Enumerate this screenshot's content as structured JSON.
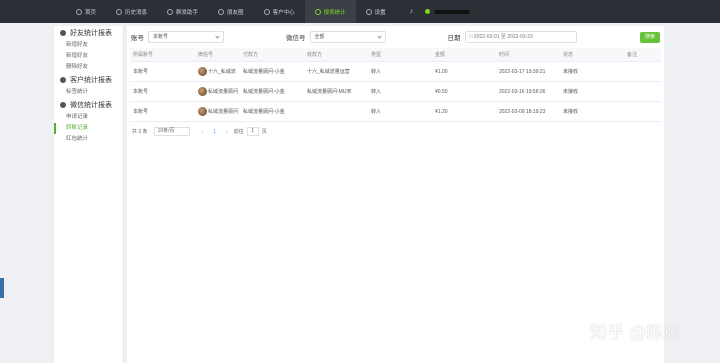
{
  "topnav": {
    "items": [
      {
        "label": "首页",
        "icon": "home-icon",
        "active": false
      },
      {
        "label": "历史消息",
        "icon": "clock-icon",
        "active": false
      },
      {
        "label": "群发助手",
        "icon": "send-icon",
        "active": false
      },
      {
        "label": "朋友圈",
        "icon": "image-icon",
        "active": false
      },
      {
        "label": "客户中心",
        "icon": "user-icon",
        "active": false
      },
      {
        "label": "报表统计",
        "icon": "chart-icon",
        "active": true
      },
      {
        "label": "设置",
        "icon": "gear-icon",
        "active": false
      }
    ],
    "accent": "#7ed321"
  },
  "sidebar": {
    "groups": [
      {
        "title": "好友统计报表",
        "items": [
          "新增好友",
          "新增好友",
          "删除好友"
        ]
      },
      {
        "title": "客户统计报表",
        "items": [
          "标签统计"
        ]
      },
      {
        "title": "微信统计报表",
        "items": [
          "申请记录",
          "转账记录",
          "红包统计"
        ]
      }
    ],
    "active_item": "转账记录",
    "active_color": "#52b234"
  },
  "filters": {
    "account_label": "账号",
    "account_value": "本账号",
    "wechat_label": "微信号",
    "wechat_value": "全部",
    "date_label": "日期",
    "date_range": "2022-03-01 至 2022-03-23",
    "search_label": "搜索"
  },
  "table": {
    "headers": [
      "所属账号",
      "微信号",
      "付款方",
      "收款方",
      "类型",
      "金额",
      "时间",
      "状态",
      "备注"
    ],
    "rows": [
      [
        "本账号",
        "十六_私域流",
        "私域流量顾问-小金",
        "十六_私域流量运营",
        "转入",
        "¥1.00",
        "2022-03-17 19:39:21",
        "未接收",
        ""
      ],
      [
        "本账号",
        "私域流量顾问",
        "私域流量顾问-小金",
        "私域流量顾问-MU宋",
        "转入",
        "¥0.50",
        "2022-03-16 19:56:26",
        "未接收",
        ""
      ],
      [
        "本账号",
        "私域流量顾问",
        "私域流量顾问-小金",
        "",
        "转入",
        "¥1.20",
        "2022-03-09 18:19:23",
        "未接收",
        ""
      ]
    ]
  },
  "pager": {
    "total": "共 3 条",
    "size": "10条/页",
    "current": "1",
    "goto_label": "前往",
    "goto_value": "1",
    "page_suffix": "页"
  },
  "watermark": "知乎 @陈风"
}
